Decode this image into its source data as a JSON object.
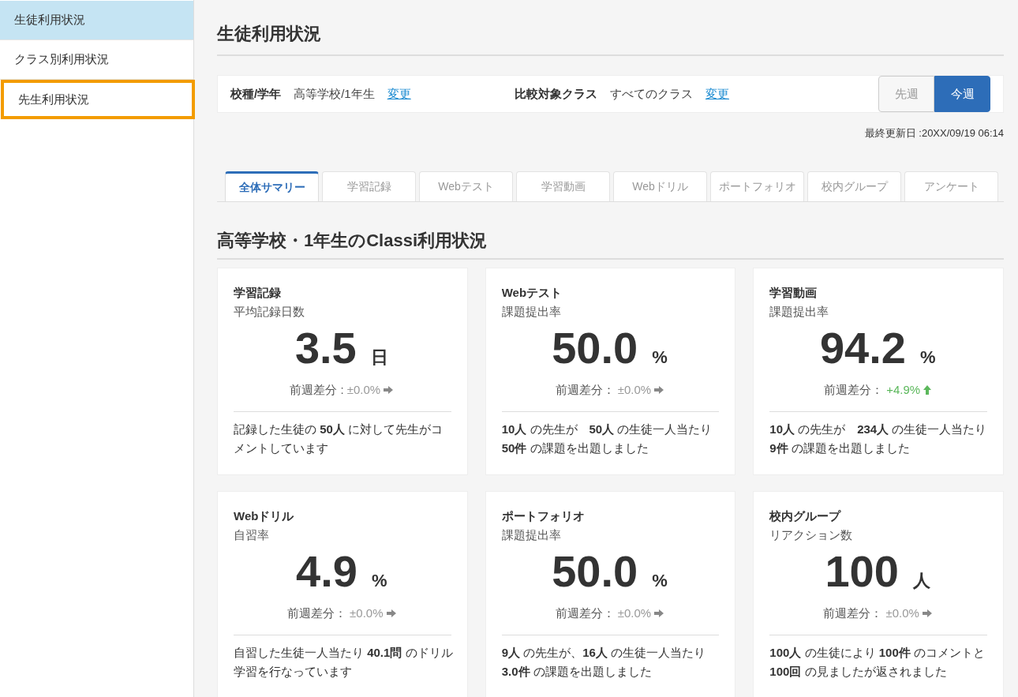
{
  "sidebar": {
    "items": [
      {
        "label": "生徒利用状況",
        "selected": true,
        "highlighted": false
      },
      {
        "label": "クラス別利用状況",
        "selected": false,
        "highlighted": false
      },
      {
        "label": "先生利用状況",
        "selected": false,
        "highlighted": true
      }
    ]
  },
  "page_title": "生徒利用状況",
  "filters": [
    {
      "label": "校種/学年",
      "value": "高等学校/1年生",
      "link": "変更"
    },
    {
      "label": "比較対象クラス",
      "value": "すべてのクラス",
      "link": "変更"
    }
  ],
  "week_toggle": [
    {
      "label": "先週",
      "selected": false
    },
    {
      "label": "今週",
      "selected": true
    }
  ],
  "updated": "最終更新日 :20XX/09/19 06:14",
  "tabs": [
    {
      "label": "全体サマリー",
      "selected": true
    },
    {
      "label": "学習記録",
      "selected": false
    },
    {
      "label": "Webテスト",
      "selected": false
    },
    {
      "label": "学習動画",
      "selected": false
    },
    {
      "label": "Webドリル",
      "selected": false
    },
    {
      "label": "ポートフォリオ",
      "selected": false
    },
    {
      "label": "校内グループ",
      "selected": false
    },
    {
      "label": "アンケート",
      "selected": false
    }
  ],
  "section_title": "高等学校・1年生のClassi利用状況",
  "cards": [
    {
      "title": "学習記録",
      "metric": "平均記録日数",
      "value": "3.5",
      "unit": "日",
      "diff_label": "前週差分 :",
      "diff": "±0.0%",
      "kind": "flat",
      "description": "記録した生徒の **50人** に対して先生がコメントしています"
    },
    {
      "title": "Webテスト",
      "metric": "課題提出率",
      "value": "50.0",
      "unit": "%",
      "diff_label": "前週差分：",
      "diff": "±0.0%",
      "kind": "flat",
      "description": "**10人** の先生が　**50人** の生徒一人当たり **50件** の課題を出題しました"
    },
    {
      "title": "学習動画",
      "metric": "課題提出率",
      "value": "94.2",
      "unit": "%",
      "diff_label": "前週差分：",
      "diff": "+4.9%",
      "kind": "up",
      "description": "**10人** の先生が　**234人** の生徒一人当たり **9件** の課題を出題しました"
    },
    {
      "title": "Webドリル",
      "metric": "自習率",
      "value": "4.9",
      "unit": "%",
      "diff_label": "前週差分：",
      "diff": "±0.0%",
      "kind": "flat",
      "description": "自習した生徒一人当たり **40.1問** のドリル学習を行なっています"
    },
    {
      "title": "ポートフォリオ",
      "metric": "課題提出率",
      "value": "50.0",
      "unit": "%",
      "diff_label": "前週差分：",
      "diff": "±0.0%",
      "kind": "flat",
      "description": "**9人** の先生が、**16人** の生徒一人当たり **3.0件** の課題を出題しました"
    },
    {
      "title": "校内グループ",
      "metric": "リアクション数",
      "value": "100",
      "unit": "人",
      "diff_label": "前週差分：",
      "diff": "±0.0%",
      "kind": "flat",
      "description": "**100人** の生徒により **100件** のコメントと **100回** の見ましたが返されました"
    }
  ]
}
